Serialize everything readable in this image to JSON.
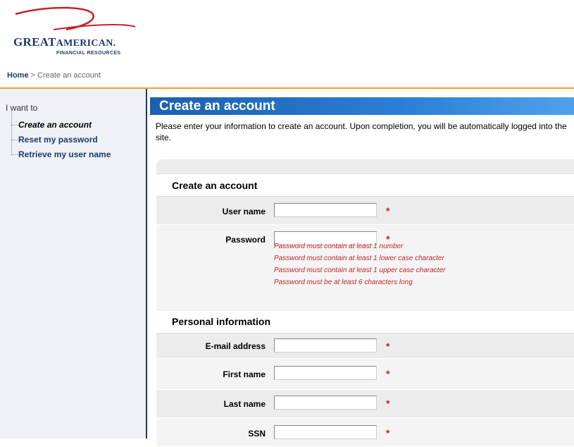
{
  "logo": {
    "brand_first": "GREAT",
    "brand_second": "AMERICAN.",
    "tagline": "FINANCIAL RESOURCES"
  },
  "breadcrumb": {
    "home": "Home",
    "separator": ">",
    "current": "Create an account"
  },
  "sidebar": {
    "heading": "I want to",
    "items": [
      {
        "label": "Create an account",
        "active": true
      },
      {
        "label": "Reset my password",
        "active": false
      },
      {
        "label": "Retrieve my user name",
        "active": false
      }
    ]
  },
  "main": {
    "title": "Create an account",
    "intro": "Please enter your information to create an account. Upon completion, you will be automatically logged into the site."
  },
  "form": {
    "section_account": "Create an account",
    "section_personal": "Personal information",
    "required_marker": "*",
    "fields": {
      "username": {
        "label": "User name",
        "value": ""
      },
      "password": {
        "label": "Password",
        "value": ""
      },
      "email": {
        "label": "E-mail address",
        "value": ""
      },
      "first_name": {
        "label": "First name",
        "value": ""
      },
      "last_name": {
        "label": "Last name",
        "value": ""
      },
      "ssn": {
        "label": "SSN",
        "value": ""
      }
    },
    "password_rules": [
      "Password must contain at least 1 number",
      "Password must contain at least 1 lower case character",
      "Password must contain at least 1 upper case character",
      "Password must be at least 6 characters long"
    ]
  },
  "colors": {
    "brand_navy": "#1c3a6e",
    "accent_orange": "#f0a030",
    "title_blue": "#2b7fd6",
    "error_red": "#c0262c"
  }
}
